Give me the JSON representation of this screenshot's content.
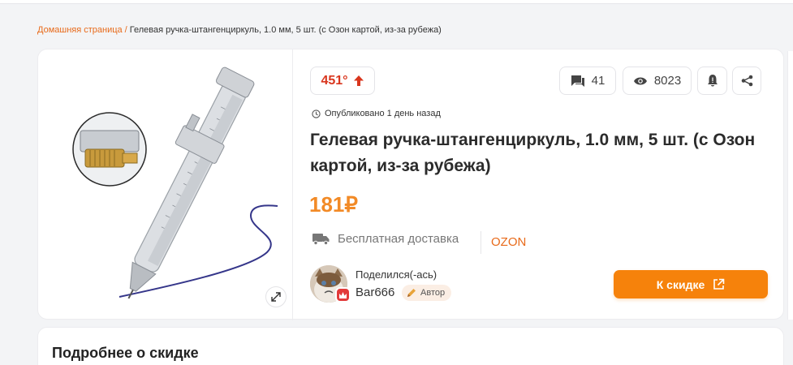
{
  "breadcrumb": {
    "home": "Домашняя страница",
    "separator": "/",
    "current": "Гелевая ручка-штангенциркуль, 1.0 мм, 5 шт. (с Озон картой, из-за рубежа)"
  },
  "deal": {
    "temperature": "451°",
    "comments": "41",
    "views": "8023",
    "published": "Опубликовано 1 день назад",
    "title": "Гелевая ручка-штангенциркуль, 1.0 мм, 5 шт. (с Озон картой, из-за рубежа)",
    "price": "181₽",
    "delivery": "Бесплатная доставка",
    "store": "OZON",
    "shared_label": "Поделился(-ась)",
    "username": "Bar666",
    "author_tag": "Автор",
    "button_label": "К скидке"
  },
  "details": {
    "title": "Подробнее о скидке"
  },
  "icons": {
    "temperature": "arrow-up-icon",
    "comments": "comment-icon",
    "views": "eye-icon",
    "bell": "bell-icon",
    "share": "share-icon",
    "clock": "clock-icon",
    "truck": "truck-icon",
    "pencil": "pencil-icon",
    "external": "external-link-icon",
    "expand": "expand-icon"
  },
  "colors": {
    "accent": "#f6820b",
    "temperature": "#d9361e",
    "price": "#f28a26",
    "link": "#e86a1a"
  }
}
